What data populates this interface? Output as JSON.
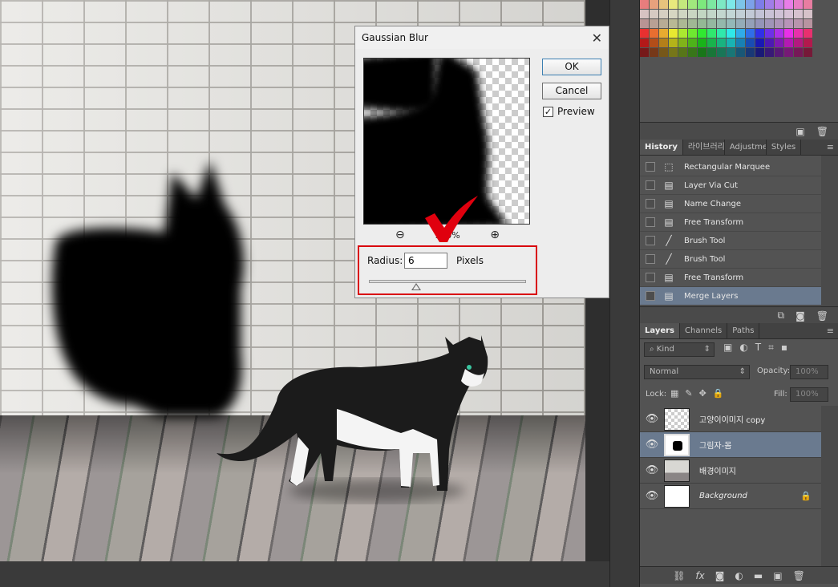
{
  "dialog": {
    "title": "Gaussian Blur",
    "close_glyph": "✕",
    "ok_label": "OK",
    "cancel_label": "Cancel",
    "preview_label": "Preview",
    "preview_checked": true,
    "zoom_out_icon": "zoom-out-icon",
    "zoom_in_icon": "zoom-in-icon",
    "zoom_level": "100%",
    "radius_label": "Radius:",
    "radius_value": "6",
    "radius_unit": "Pixels",
    "slider_fraction": 0.3
  },
  "history": {
    "tabs": [
      "History",
      "라이브러리",
      "Adjustme",
      "Styles"
    ],
    "items": [
      {
        "label": "Rectangular Marquee",
        "icon": "marquee-icon"
      },
      {
        "label": "Layer Via Cut",
        "icon": "document-icon"
      },
      {
        "label": "Name Change",
        "icon": "document-icon"
      },
      {
        "label": "Free Transform",
        "icon": "document-icon"
      },
      {
        "label": "Brush Tool",
        "icon": "brush-icon"
      },
      {
        "label": "Brush Tool",
        "icon": "brush-icon"
      },
      {
        "label": "Free Transform",
        "icon": "document-icon"
      },
      {
        "label": "Merge Layers",
        "icon": "document-icon"
      }
    ],
    "selected_index": 7
  },
  "layers": {
    "tabs": [
      "Layers",
      "Channels",
      "Paths"
    ],
    "filter_kind": "Kind",
    "blend_mode": "Normal",
    "opacity_label": "Opacity:",
    "opacity_value": "100%",
    "lock_label": "Lock:",
    "fill_label": "Fill:",
    "fill_value": "100%",
    "items": [
      {
        "name": "고양이이미지 copy",
        "italic": false,
        "locked": false
      },
      {
        "name": "그림자-몸",
        "italic": false,
        "locked": false
      },
      {
        "name": "배경이미지",
        "italic": false,
        "locked": false
      },
      {
        "name": "Background",
        "italic": true,
        "locked": true
      }
    ],
    "selected_index": 1
  },
  "colors": {
    "accent_red": "#d9000c",
    "selection": "#6a7a8f"
  }
}
